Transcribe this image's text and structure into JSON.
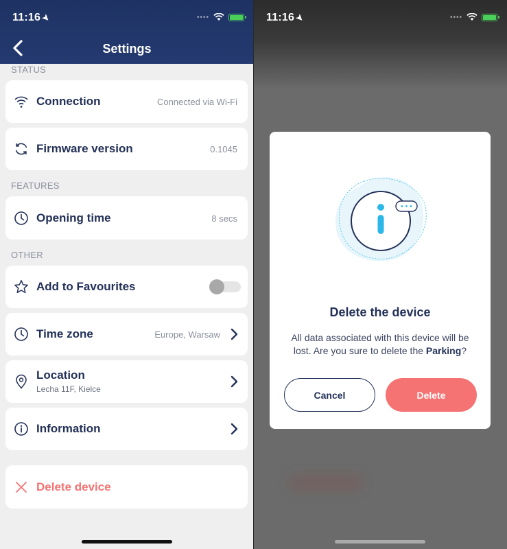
{
  "status_bar": {
    "time": "11:16"
  },
  "settings": {
    "title": "Settings",
    "sections": {
      "status": "STATUS",
      "features": "FEATURES",
      "other": "OTHER"
    },
    "connection": {
      "label": "Connection",
      "value": "Connected via Wi-Fi"
    },
    "firmware": {
      "label": "Firmware version",
      "value": "0.1045"
    },
    "opening_time": {
      "label": "Opening time",
      "value": "8 secs"
    },
    "favourites": {
      "label": "Add to Favourites",
      "enabled": false
    },
    "time_zone": {
      "label": "Time zone",
      "value": "Europe, Warsaw"
    },
    "location": {
      "label": "Location",
      "value": "Lecha 11F, Kielce"
    },
    "information": {
      "label": "Information"
    },
    "delete_device": {
      "label": "Delete device"
    }
  },
  "dialog": {
    "title": "Delete the device",
    "message_prefix": "All data associated with this device will be lost. Are you sure to delete the ",
    "device_name": "Parking",
    "message_suffix": "?",
    "cancel_label": "Cancel",
    "delete_label": "Delete"
  },
  "colors": {
    "header": "#1e3263",
    "primary_text": "#233158",
    "danger": "#f57373",
    "accent": "#2bb8e8"
  },
  "icons": [
    "back-chevron-icon",
    "location-arrow-icon",
    "wifi-icon",
    "battery-icon",
    "refresh-icon",
    "clock-icon",
    "star-icon",
    "pin-icon",
    "info-icon",
    "close-x-icon",
    "chevron-right-icon"
  ]
}
